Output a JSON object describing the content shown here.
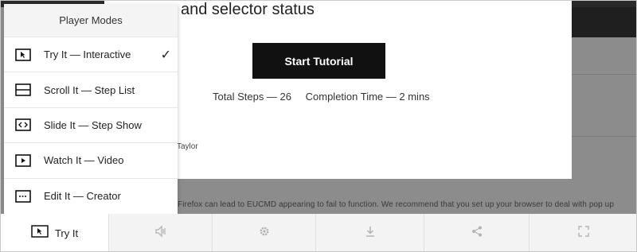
{
  "modal": {
    "heading": "and selector status",
    "start_button": "Start Tutorial",
    "total_steps": "Total Steps — 26",
    "completion_time": "Completion Time — 2 mins",
    "author_partial": "Taylor"
  },
  "background": {
    "body_text": "Firefox can lead to EUCMD appearing to fail to function. We recommend that you set up your browser to deal with pop up"
  },
  "menu": {
    "title": "Player Modes",
    "items": [
      {
        "label": "Try It — Interactive",
        "icon": "cursor-box-icon",
        "selected": true
      },
      {
        "label": "Scroll It — Step List",
        "icon": "list-box-icon",
        "selected": false
      },
      {
        "label": "Slide It — Step Show",
        "icon": "slides-box-icon",
        "selected": false
      },
      {
        "label": "Watch It — Video",
        "icon": "play-box-icon",
        "selected": false
      },
      {
        "label": "Edit It — Creator",
        "icon": "edit-box-icon",
        "selected": false
      }
    ],
    "check_glyph": "✓"
  },
  "toolbar": {
    "current_mode": "Try It",
    "buttons": [
      "audio-icon",
      "settings-icon",
      "download-icon",
      "share-icon",
      "fullscreen-icon"
    ]
  },
  "colors": {
    "overlay": "#8c8c8c",
    "button_bg": "#111111",
    "toolbar_bg": "#f3f3f3"
  }
}
